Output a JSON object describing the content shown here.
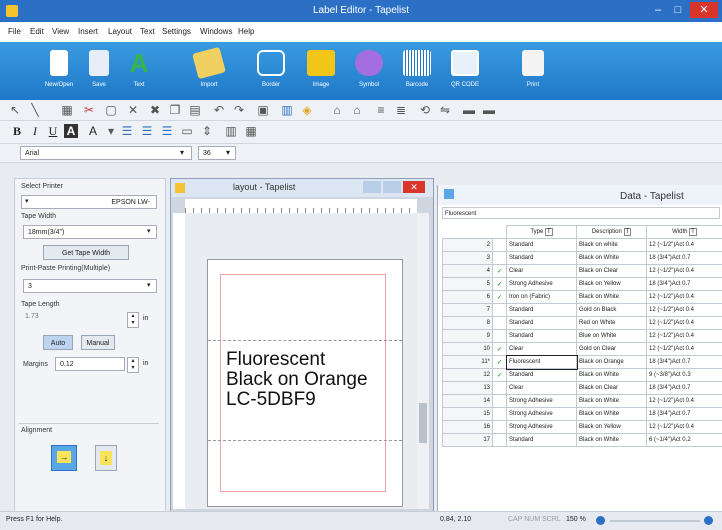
{
  "window": {
    "title": "Label Editor - Tapelist",
    "min": "–",
    "max": "□",
    "close": "✕"
  },
  "menu": [
    "File",
    "Edit",
    "View",
    "Insert",
    "Layout",
    "Text",
    "Settings",
    "Windows",
    "Help"
  ],
  "ribbon": [
    {
      "label": "New/Open",
      "icon": "new-open-icon",
      "color": "#ffffff"
    },
    {
      "label": "Save",
      "icon": "save-icon",
      "color": "#ffffff"
    },
    {
      "label": "Text",
      "icon": "text-icon",
      "color": "#33b54a"
    },
    {
      "label": "Import",
      "icon": "import-icon",
      "color": "#f0d060"
    },
    {
      "label": "Border",
      "icon": "border-icon",
      "color": "#ffffff"
    },
    {
      "label": "Image",
      "icon": "image-icon",
      "color": "#f2c618"
    },
    {
      "label": "Symbol",
      "icon": "symbol-icon",
      "color": "#a46de0"
    },
    {
      "label": "Barcode",
      "icon": "barcode-icon",
      "color": "#ffffff"
    },
    {
      "label": "QR CODE",
      "icon": "qr-code-icon",
      "color": "#ffffff"
    },
    {
      "label": "Print",
      "icon": "print-icon",
      "color": "#ffffff"
    }
  ],
  "font": {
    "name": "Arial",
    "size": "36"
  },
  "left_panel": {
    "select_printer": "Select Printer",
    "printer_value": "EPSON LW-",
    "tape_width_label": "Tape Width",
    "tape_width_value": "18mm(3/4\")",
    "get_tape_width": "Get Tape Width",
    "print_paste_label": "Print-Paste Printing(Multiple)",
    "print_paste_value": "3",
    "tape_length_label": "Tape Length",
    "tape_length_value": "1.73",
    "unit": "in",
    "auto": "Auto",
    "manual": "Manual",
    "margins_label": "Margins",
    "margins_value": "0.12",
    "alignment_label": "Alignment"
  },
  "layout_window": {
    "title": "layout - Tapelist",
    "lines": [
      "Fluorescent",
      "Black on Orange",
      "LC-5DBF9"
    ]
  },
  "data_window": {
    "title": "Data - Tapelist",
    "cell_ref": "Fluorescent",
    "columns": [
      "Type",
      "Description",
      "Width"
    ],
    "rows": [
      {
        "n": "2",
        "check": false,
        "type": "Standard",
        "desc": "Black on white",
        "width": "12 (~1/2\")Act 0.4"
      },
      {
        "n": "3",
        "check": false,
        "type": "Standard",
        "desc": "Black on White",
        "width": "18 (3/4\")Act 0.7"
      },
      {
        "n": "4",
        "check": true,
        "type": "Clear",
        "desc": "Black on Clear",
        "width": "12 (~1/2\")Act 0.4"
      },
      {
        "n": "5",
        "check": true,
        "type": "Strong Adhesive",
        "desc": "Black on Yellow",
        "width": "18 (3/4\")Act 0.7"
      },
      {
        "n": "6",
        "check": true,
        "type": "Iron on (Fabric)",
        "desc": "Black on White",
        "width": "12 (~1/2\")Act 0.4"
      },
      {
        "n": "7",
        "check": false,
        "type": "Standard",
        "desc": "Gold on Black",
        "width": "12 (~1/2\")Act 0.4"
      },
      {
        "n": "8",
        "check": false,
        "type": "Standard",
        "desc": "Red on White",
        "width": "12 (~1/2\")Act 0.4"
      },
      {
        "n": "9",
        "check": false,
        "type": "Standard",
        "desc": "Blue on White",
        "width": "12 (~1/2\")Act 0.4"
      },
      {
        "n": "10",
        "check": true,
        "type": "Clear",
        "desc": "Gold on Clear",
        "width": "12 (~1/2\")Act 0.4"
      },
      {
        "n": "11*",
        "check": true,
        "type": "Fluorescent",
        "desc": "Black on Orange",
        "width": "18 (3/4\")Act 0.7"
      },
      {
        "n": "12",
        "check": true,
        "type": "Standard",
        "desc": "Black on White",
        "width": "9 (~3/8\")Act 0.3"
      },
      {
        "n": "13",
        "check": false,
        "type": "Clear",
        "desc": "Black on Clear",
        "width": "18 (3/4\")Act 0.7"
      },
      {
        "n": "14",
        "check": false,
        "type": "Strong Adhesive",
        "desc": "Black on White",
        "width": "12 (~1/2\")Act 0.4"
      },
      {
        "n": "15",
        "check": false,
        "type": "Strong Adhesive",
        "desc": "Black on White",
        "width": "18 (3/4\")Act 0.7"
      },
      {
        "n": "16",
        "check": false,
        "type": "Strong Adhesive",
        "desc": "Black on Yellow",
        "width": "12 (~1/2\")Act 0.4"
      },
      {
        "n": "17",
        "check": false,
        "type": "Standard",
        "desc": "Black on White",
        "width": "6 (~1/4\")Act 0.2"
      }
    ]
  },
  "status": {
    "help": "Press F1 for Help.",
    "coords": "0.84, 2.10",
    "indicators": "CAP NUM SCRL",
    "zoom": "150 %"
  }
}
